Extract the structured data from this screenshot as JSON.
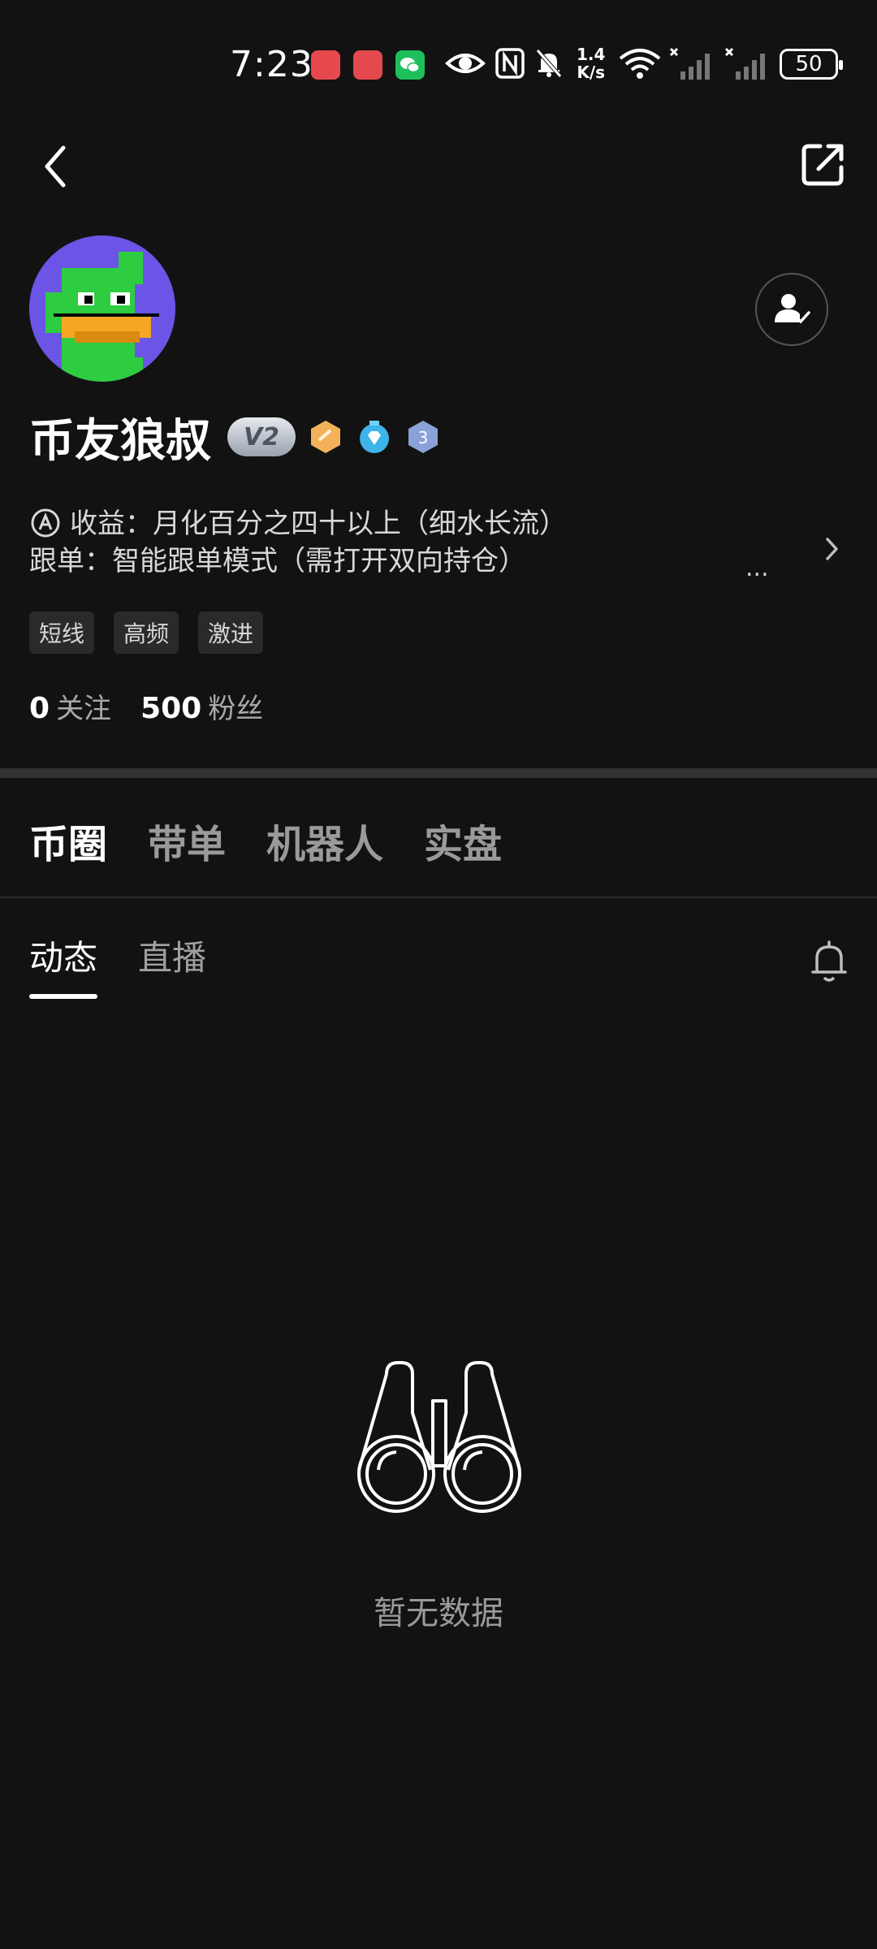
{
  "status_bar": {
    "time": "7:23",
    "net_speed_value": "1.4",
    "net_speed_unit": "K/s",
    "battery": "50"
  },
  "profile": {
    "name": "币友狼叔",
    "vip_level": "V2",
    "medal_number": "3",
    "bio_line_1": "收益：月化百分之四十以上（细水长流）",
    "bio_line_2": "跟单：智能跟单模式（需打开双向持仓）",
    "bio_more": "...",
    "tags": [
      "短线",
      "高频",
      "激进"
    ],
    "following_count": "0",
    "following_label": "关注",
    "followers_count": "500",
    "followers_label": "粉丝"
  },
  "tabs_main": [
    "币圈",
    "带单",
    "机器人",
    "实盘"
  ],
  "tabs_sub": [
    "动态",
    "直播"
  ],
  "empty_state": {
    "text": "暂无数据"
  },
  "colors": {
    "background": "#121212",
    "avatar_bg": "#6a55e6",
    "accent_white": "#ffffff"
  }
}
